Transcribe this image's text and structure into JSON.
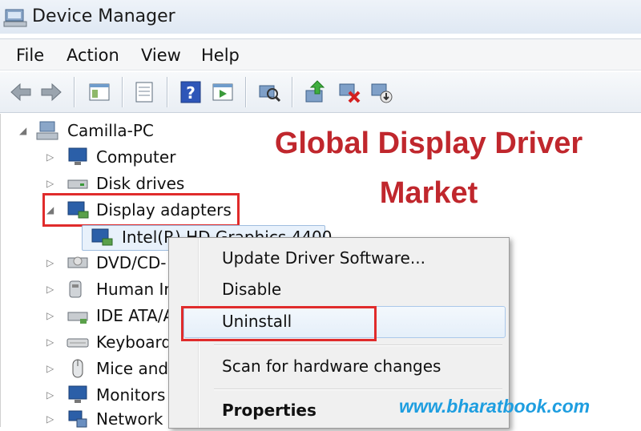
{
  "window": {
    "title": "Device Manager"
  },
  "menu": [
    "File",
    "Action",
    "View",
    "Help"
  ],
  "toolbar": {
    "buttons": [
      "back-icon",
      "forward-icon",
      "show-hide-tree-icon",
      "properties-icon",
      "help-icon",
      "action-pane-icon",
      "scan-hardware-icon",
      "update-driver-icon",
      "uninstall-icon",
      "disable-device-icon"
    ]
  },
  "tree": {
    "root": "Camilla-PC",
    "items": [
      "Computer",
      "Disk drives",
      "Display adapters",
      "Intel(R) HD Graphics 4400",
      "DVD/CD-",
      "Human Ir",
      "IDE ATA/A",
      "Keyboard",
      "Mice and",
      "Monitors",
      "Network a"
    ]
  },
  "context_menu": {
    "items": [
      "Update Driver Software...",
      "Disable",
      "Uninstall",
      "Scan for hardware changes",
      "Properties"
    ]
  },
  "overlay": {
    "headline_line1": "Global Display Driver",
    "headline_line2": "Market",
    "watermark": "www.bharatbook.com"
  },
  "colors": {
    "highlight_red": "#e02b2b",
    "headline_red": "#c0272d",
    "watermark_blue": "#1e9ee0"
  }
}
